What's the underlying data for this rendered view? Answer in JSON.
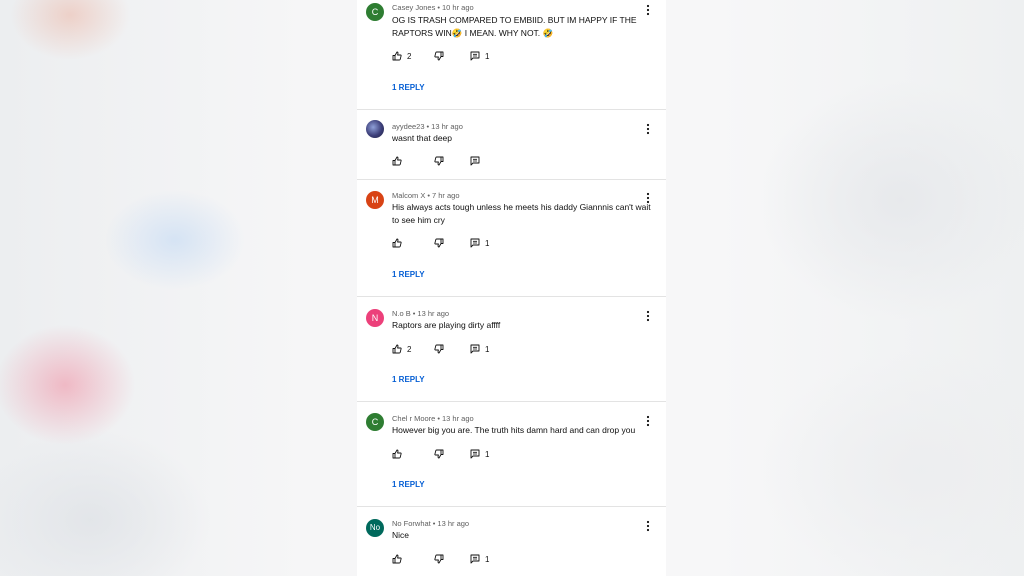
{
  "meta_separator": "•",
  "comments": [
    {
      "author": "Casey Jones",
      "time": "10 hr ago",
      "avatar_letter": "C",
      "avatar_color": "#2e7d32",
      "text": "OG IS TRASH COMPARED TO EMBIID. BUT IM HAPPY IF THE RAPTORS WIN🤣 I MEAN. WHY NOT. 🤣",
      "likes": "2",
      "replies_count": "1",
      "replies_link": "1 REPLY"
    },
    {
      "author": "ayydee23",
      "time": "13 hr ago",
      "avatar_letter": "",
      "avatar_color": "#3d3f7a",
      "text": "wasnt that deep",
      "likes": "",
      "replies_count": "",
      "replies_link": ""
    },
    {
      "author": "Malcom X",
      "time": "7 hr ago",
      "avatar_letter": "M",
      "avatar_color": "#d84315",
      "text": "His always acts tough unless he meets his daddy Giannnis can't wait to see him cry",
      "likes": "",
      "replies_count": "1",
      "replies_link": "1 REPLY"
    },
    {
      "author": "N.o B",
      "time": "13 hr ago",
      "avatar_letter": "N",
      "avatar_color": "#ec407a",
      "text": "Raptors are playing dirty affff",
      "likes": "2",
      "replies_count": "1",
      "replies_link": "1 REPLY"
    },
    {
      "author": "Chel r Moore",
      "time": "13 hr ago",
      "avatar_letter": "C",
      "avatar_color": "#2e7d32",
      "text": "However big you are.  The truth hits damn hard and can drop you",
      "likes": "",
      "replies_count": "1",
      "replies_link": "1 REPLY"
    },
    {
      "author": "No Forwhat",
      "time": "13 hr ago",
      "avatar_letter": "No",
      "avatar_color": "#00695c",
      "text": "Nice",
      "likes": "",
      "replies_count": "1",
      "replies_link": ""
    }
  ],
  "icons": {
    "like": "thumb-up-icon",
    "dislike": "thumb-down-icon",
    "reply": "comment-icon",
    "menu": "more-vert-icon"
  },
  "colors": {
    "link_blue": "#065fd4",
    "meta_gray": "#606060"
  }
}
